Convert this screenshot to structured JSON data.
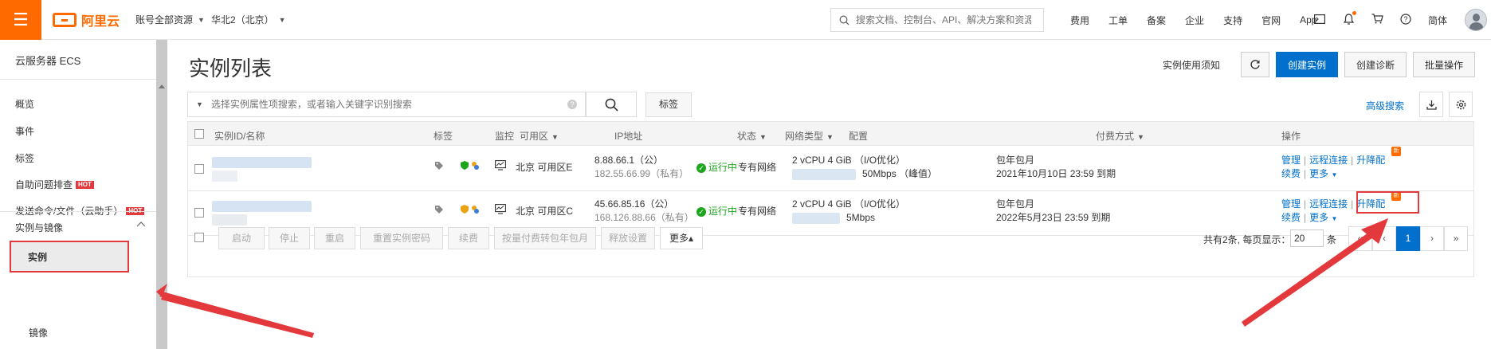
{
  "topbar": {
    "menu_icon": "hamburger-icon",
    "logo_text": "阿里云",
    "account_scope": "账号全部资源",
    "region": "华北2（北京）",
    "search_placeholder": "搜索文档、控制台、API、解决方案和资源",
    "links": [
      "费用",
      "工单",
      "备案",
      "企业",
      "支持",
      "官网",
      "App"
    ],
    "language": "简体"
  },
  "sidebar": {
    "title": "云服务器 ECS",
    "items": [
      "概览",
      "事件",
      "标签",
      "自助问题排查",
      "发送命令/文件（云助手）"
    ],
    "hot_badge": "HOT",
    "section": "实例与镜像",
    "active_item": "实例",
    "sub_item": "镜像"
  },
  "header": {
    "title": "实例列表",
    "usage_notice": "实例使用须知",
    "create_label": "创建实例",
    "diagnose_label": "创建诊断",
    "batch_label": "批量操作"
  },
  "filter": {
    "placeholder": "选择实例属性项搜索，或者输入关键字识别搜索",
    "tag_label": "标签",
    "advanced_search": "高级搜索"
  },
  "table": {
    "headers": [
      "实例ID/名称",
      "标签",
      "监控",
      "可用区",
      "IP地址",
      "状态",
      "网络类型",
      "配置",
      "付费方式",
      "操作"
    ],
    "rows": [
      {
        "zone": "北京 可用区E",
        "ip_public": "8.88.66.1（公）",
        "ip_private": "182.55.66.99（私有）",
        "status": "运行中",
        "network": "专有网络",
        "spec": "2 vCPU 4 GiB （I/O优化）",
        "bandwidth": "50Mbps （峰值）",
        "billing": "包年包月",
        "expire": "2021年10月10日 23:59 到期",
        "ops": [
          "管理",
          "远程连接",
          "升降配",
          "续费",
          "更多"
        ]
      },
      {
        "zone": "北京 可用区C",
        "ip_public": "45.66.85.16（公）",
        "ip_private": "168.126.88.66（私有）",
        "status": "运行中",
        "network": "专有网络",
        "spec": "2 vCPU 4 GiB （I/O优化）",
        "bandwidth": "5Mbps",
        "billing": "包年包月",
        "expire": "2022年5月23日 23:59 到期",
        "ops": [
          "管理",
          "远程连接",
          "升降配",
          "续费",
          "更多"
        ]
      }
    ],
    "footer_buttons": [
      "启动",
      "停止",
      "重启",
      "重置实例密码",
      "续费",
      "按量付费转包年包月",
      "释放设置",
      "更多▴"
    ],
    "pager_text": "共有2条, 每页显示：",
    "page_size": "20",
    "page_size_suffix": "条",
    "pages": [
      "«",
      "‹",
      "1",
      "›",
      "»"
    ]
  },
  "colors": {
    "brand_orange": "#ff6a00",
    "primary_blue": "#0070cc",
    "annotation_red": "#e4393c",
    "status_green": "#1ea51e"
  }
}
